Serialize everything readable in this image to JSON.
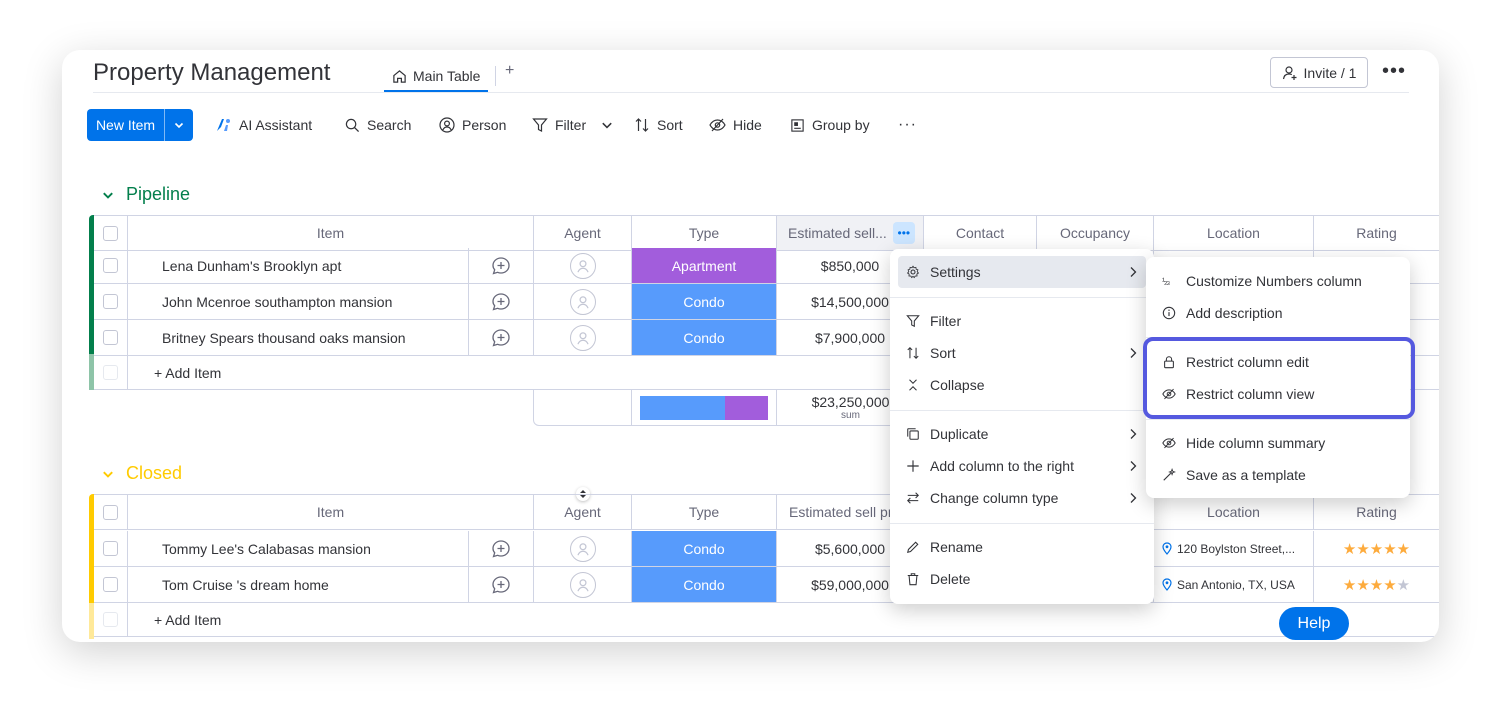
{
  "header": {
    "title": "Property Management",
    "tab_main": "Main Table",
    "tab_add": "+",
    "invite": "Invite / 1",
    "more": "•••"
  },
  "toolbar": {
    "new_item": "New Item",
    "ai_assistant": "AI Assistant",
    "search": "Search",
    "person": "Person",
    "filter": "Filter",
    "sort": "Sort",
    "hide": "Hide",
    "group_by": "Group by",
    "more": "···"
  },
  "columns": {
    "item": "Item",
    "agent": "Agent",
    "type": "Type",
    "estimated_truncated": "Estimated sell...",
    "estimated_closed": "Estimated sell pr",
    "contact": "Contact",
    "occupancy": "Occupancy",
    "location": "Location",
    "rating": "Rating"
  },
  "pipeline": {
    "title": "Pipeline",
    "color": "#037f4c",
    "rows": [
      {
        "item": "Lena Dunham's Brooklyn apt",
        "type": "Apartment",
        "price": "$850,000"
      },
      {
        "item": "John Mcenroe southampton mansion",
        "type": "Condo",
        "price": "$14,500,000"
      },
      {
        "item": "Britney Spears thousand oaks mansion",
        "type": "Condo",
        "price": "$7,900,000"
      }
    ],
    "add_item": "+ Add Item",
    "sum_value": "$23,250,000",
    "sum_label": "sum"
  },
  "closed": {
    "title": "Closed",
    "color": "#ffcb00",
    "rows": [
      {
        "item": "Tommy Lee's Calabasas mansion",
        "type": "Condo",
        "price": "$5,600,000",
        "location": "120 Boylston Street,...",
        "rating": 5
      },
      {
        "item": "Tom Cruise 's dream home",
        "type": "Condo",
        "price": "$59,000,000",
        "location": "San Antonio, TX, USA",
        "rating": 4
      }
    ],
    "add_item": "+ Add Item"
  },
  "context_menu": {
    "settings": "Settings",
    "filter": "Filter",
    "sort": "Sort",
    "collapse": "Collapse",
    "duplicate": "Duplicate",
    "add_column_right": "Add column to the right",
    "change_column_type": "Change column type",
    "rename": "Rename",
    "delete": "Delete"
  },
  "settings_submenu": {
    "customize_numbers": "Customize Numbers column",
    "add_description": "Add description",
    "restrict_edit": "Restrict column edit",
    "restrict_view": "Restrict column view",
    "hide_summary": "Hide column summary",
    "save_template": "Save as a template",
    "highlight_color": "#5559df"
  },
  "help": "Help",
  "colors": {
    "primary": "#0073ea",
    "apartment": "#a25ddc",
    "condo": "#579bfc",
    "star": "#fdab3d"
  }
}
